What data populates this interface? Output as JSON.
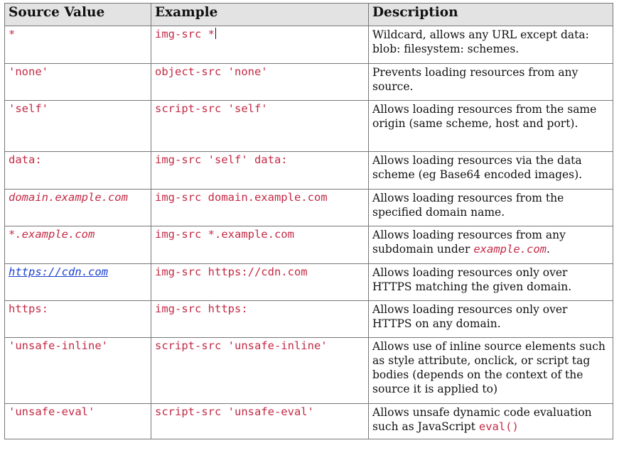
{
  "table": {
    "headers": [
      "Source Value",
      "Example",
      "Description"
    ],
    "rows": [
      {
        "source": "*",
        "example": "img-src *",
        "description": "Wildcard, allows any URL except data: blob: filesystem: schemes."
      },
      {
        "source": "'none'",
        "example": "object-src 'none'",
        "description": "Prevents loading resources from any source."
      },
      {
        "source": "'self'",
        "example": "script-src 'self'",
        "description": "Allows loading resources from the same origin (same scheme, host and port)."
      },
      {
        "source": "data:",
        "example": "img-src 'self' data:",
        "description": "Allows loading resources via the data scheme (eg Base64 encoded images)."
      },
      {
        "source": "domain.example.com",
        "example": "img-src domain.example.com",
        "description": "Allows loading resources from the specified domain name."
      },
      {
        "source": "*.example.com",
        "example": "img-src *.example.com",
        "description_prefix": "Allows loading resources from any subdomain under ",
        "description_code": "example.com",
        "description_suffix": "."
      },
      {
        "source": "https://cdn.com",
        "example": "img-src https://cdn.com",
        "description": "Allows loading resources only over HTTPS matching the given domain."
      },
      {
        "source": "https:",
        "example": "img-src https:",
        "description": "Allows loading resources only over HTTPS on any domain."
      },
      {
        "source": "'unsafe-inline'",
        "example": "script-src 'unsafe-inline'",
        "description": "Allows use of inline source elements such as style attribute, onclick, or script tag bodies (depends on the context of the source it is applied to)"
      },
      {
        "source": "'unsafe-eval'",
        "example": "script-src 'unsafe-eval'",
        "description_prefix": "Allows unsafe dynamic code evaluation such as JavaScript ",
        "description_code": "eval()",
        "description_suffix": ""
      }
    ]
  }
}
